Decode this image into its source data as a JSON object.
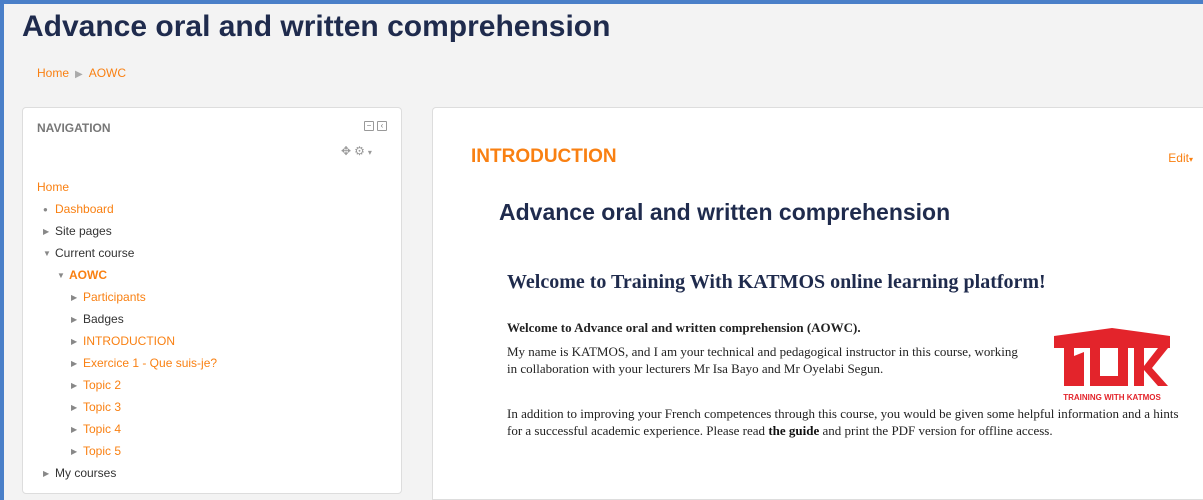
{
  "page": {
    "title": "Advance oral and written comprehension"
  },
  "breadcrumb": {
    "home": "Home",
    "separator": "▶",
    "current": "AOWC"
  },
  "navigation": {
    "title": "NAVIGATION",
    "items": [
      {
        "label": "Home"
      },
      {
        "label": "Dashboard"
      },
      {
        "label": "Site pages"
      },
      {
        "label": "Current course"
      },
      {
        "label": "AOWC"
      },
      {
        "label": "Participants"
      },
      {
        "label": "Badges"
      },
      {
        "label": "INTRODUCTION"
      },
      {
        "label": "Exercice 1 - Que suis-je?"
      },
      {
        "label": "Topic 2"
      },
      {
        "label": "Topic 3"
      },
      {
        "label": "Topic 4"
      },
      {
        "label": "Topic 5"
      },
      {
        "label": "My courses"
      }
    ]
  },
  "main": {
    "section_title": "INTRODUCTION",
    "edit_label": "Edit",
    "summary_heading": "Advance oral and written comprehension",
    "welcome_heading": "Welcome to Training With KATMOS online learning platform!",
    "welcome_line": "Welcome to Advance oral and written comprehension (AOWC).",
    "intro_paragraph": "My name is KATMOS, and I am your technical and pedagogical instructor in this course, working in collaboration with your lecturers  Mr Isa Bayo and Mr Oyelabi Segun.",
    "extra_before": "In addition to improving your French competences through this course, you would be given some helpful information and a hints for a successful academic experience. Please read ",
    "extra_guide": "the guide",
    "extra_after": " and print the PDF version for offline access.",
    "logo_tagline": "TRAINING WITH KATMOS"
  },
  "colors": {
    "accent": "#f98012",
    "heading": "#1f2b4d",
    "frame": "#4a7fc8",
    "logo": "#e3242b"
  },
  "icons": [
    "collapse-icon",
    "dock-icon",
    "move-icon",
    "gear-icon",
    "caret-down-icon",
    "triangle-right-icon",
    "triangle-down-icon",
    "bullet-icon"
  ]
}
